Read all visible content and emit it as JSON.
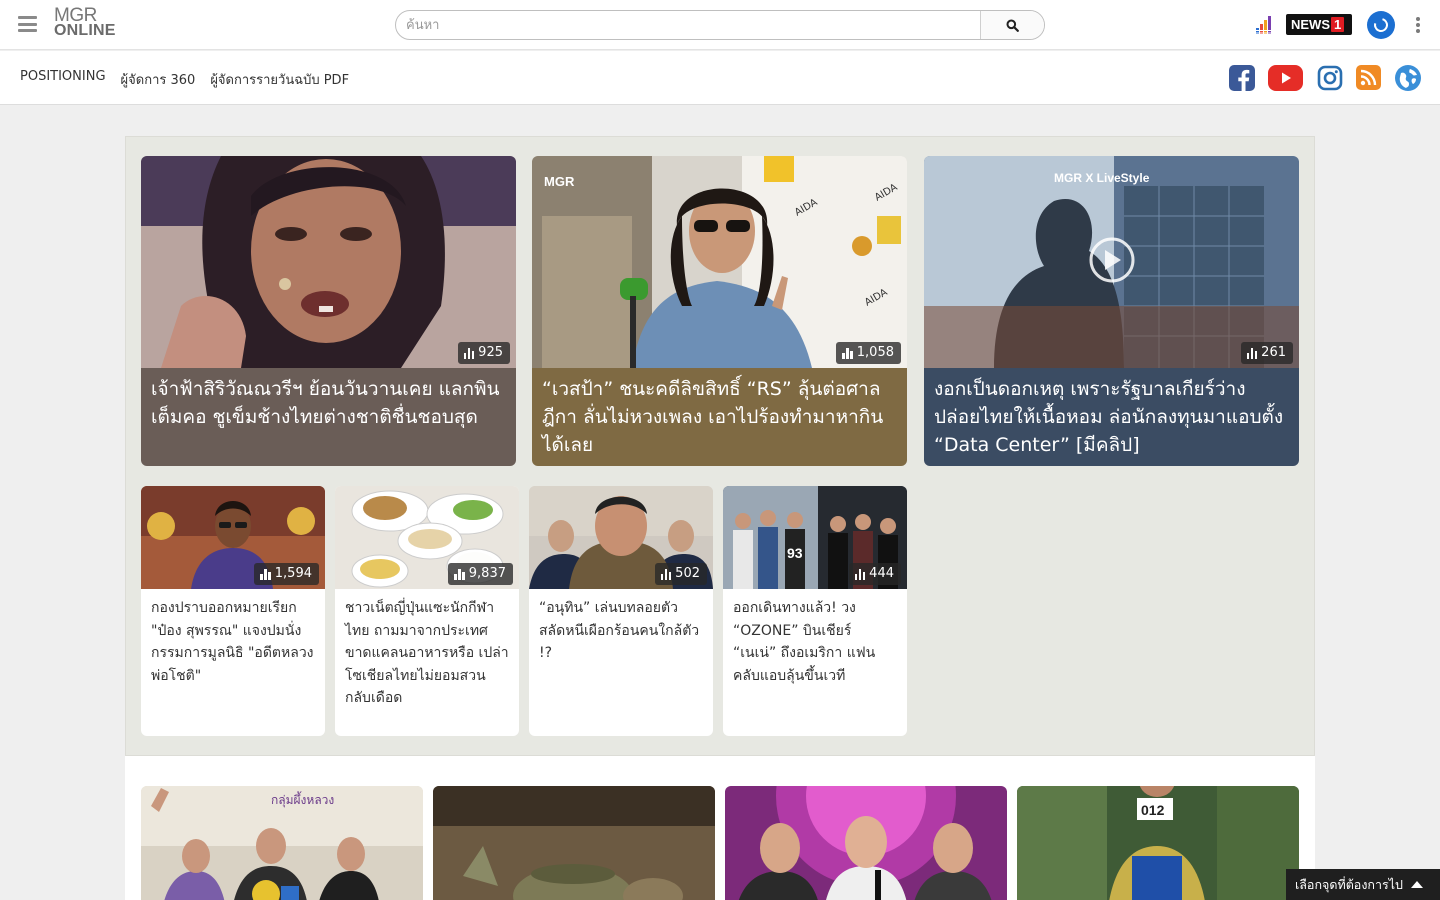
{
  "header": {
    "logo_line1": "MGR",
    "logo_line2": "ONLINE",
    "search_placeholder": "ค้นหา",
    "news1_label": "NEWS",
    "news1_number": "1"
  },
  "nav": {
    "links": [
      "POSITIONING",
      "ผู้จัดการ 360",
      "ผู้จัดการรายวันฉบับ PDF"
    ],
    "social": [
      "facebook-icon",
      "youtube-icon",
      "instagram-icon",
      "rss-icon",
      "globe-icon"
    ],
    "colors": {
      "facebook": "#3b5998",
      "youtube": "#e52d27",
      "instagram": "#2a6fb0",
      "rss": "#f08a24",
      "globe": "#3a8fd8"
    }
  },
  "featured": [
    {
      "title": "เจ้าฟ้าสิริวัณณวรีฯ ย้อนวันวานเคย แลกพินเต็มคอ ชูเข็มช้างไทยต่างชาติชื่นชอบสุด",
      "views": "925",
      "caption_color": "#6a5d57"
    },
    {
      "title": "“เวสป้า” ชนะคดีลิขสิทธิ์ “RS” ลุ้นต่อศาลฎีกา ลั่นไม่หวงเพลง เอาไปร้องทำมาหากินได้เลย",
      "views": "1,058",
      "caption_color": "#7f6a43",
      "logo": "MGR"
    },
    {
      "title": "งอกเป็นดอกเหตุ เพราะรัฐบาลเกียร์ว่าง ปล่อยไทยให้เนื้อหอม ล่อนักลงทุนมาแอบตั้ง “Data Center” [มีคลิป]",
      "views": "261",
      "caption_color": "#3b4c63",
      "logo": "MGR X LiveStyle"
    }
  ],
  "small": [
    {
      "title": "กองปราบออกหมายเรียก \"ป๋อง สุพรรณ\" แจงปมนั่งกรรมการมูลนิธิ \"อดีตหลวงพ่อโชติ\"",
      "views": "1,594"
    },
    {
      "title": "ชาวเน็ตญี่ปุ่นแซะนักกีฬาไทย ถามมาจากประเทศขาดแคลนอาหารหรือ เปล่า โซเชียลไทยไม่ยอมสวนกลับเดือด",
      "views": "9,837"
    },
    {
      "title": "“อนุทิน” เล่นบทลอยตัว สลัดหนีเผือกร้อนคนใกล้ตัว !?",
      "views": "502"
    },
    {
      "title": "ออกเดินทางแล้ว! วง “OZONE” บินเชียร์ “เนเน่” ถึงอเมริกา แฟนคลับแอบลุ้นขึ้นเวที",
      "views": "444"
    }
  ],
  "bottom_overlay_texts": [
    "กลุ่มผึ้งหลวง",
    "012"
  ],
  "jump_label": "เลือกจุดที่ต้องการไป"
}
